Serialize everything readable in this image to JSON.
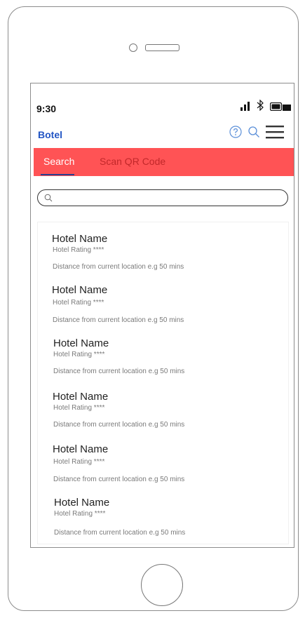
{
  "status_bar": {
    "time": "9:30",
    "icons": [
      "signal-icon",
      "bluetooth-icon",
      "battery-icon"
    ]
  },
  "header": {
    "brand": "Botel",
    "actions": [
      "help-icon",
      "search-icon",
      "menu-icon"
    ],
    "accent_color": "#2255c4"
  },
  "tabs": [
    {
      "label": "Search",
      "active": true
    },
    {
      "label": "Scan QR Code",
      "active": false
    }
  ],
  "tab_bar_color": "#ff5355",
  "search": {
    "value": "",
    "placeholder": ""
  },
  "hotels": [
    {
      "name": "Hotel Name",
      "rating": "Hotel Rating ****",
      "distance": "Distance from current location e.g 50 mins"
    },
    {
      "name": "Hotel Name",
      "rating": "Hotel Rating ****",
      "distance": "Distance from current location e.g 50 mins"
    },
    {
      "name": "Hotel Name",
      "rating": "Hotel Rating ****",
      "distance": "Distance from current location e.g 50 mins"
    },
    {
      "name": "Hotel Name",
      "rating": "Hotel Rating ****",
      "distance": "Distance from current location e.g 50 mins"
    },
    {
      "name": "Hotel Name",
      "rating": "Hotel Rating ****",
      "distance": "Distance from current location e.g 50 mins"
    },
    {
      "name": "Hotel Name",
      "rating": "Hotel Rating ****",
      "distance": "Distance from current location e.g 50 mins"
    }
  ]
}
